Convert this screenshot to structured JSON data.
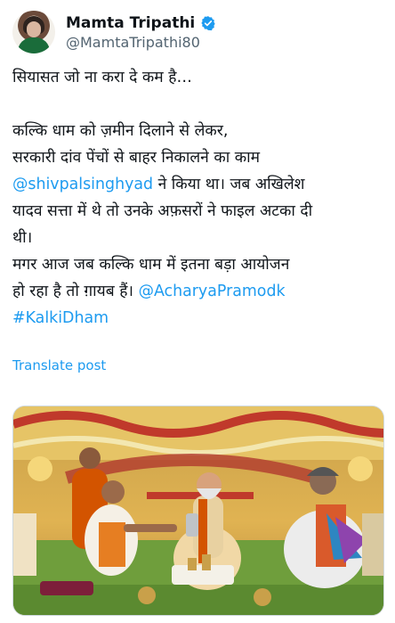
{
  "author": {
    "display_name": "Mamta Tripathi",
    "handle": "@MamtaTripathi80",
    "verified": true,
    "avatar_icon": "profile-avatar"
  },
  "post": {
    "line1": "सियासत जो ना करा दे कम है…",
    "line2": "कल्कि धाम को ज़मीन दिलाने से लेकर,",
    "line3": "सरकारी दांव पेंचों से बाहर निकालने का काम",
    "mention1": "@shivpalsinghyad",
    "line4_rest": " ने किया था। जब अखिलेश",
    "line5": "यादव सत्ता में थे तो उनके अफ़सरों ने फाइल अटका दी",
    "line6": "थी।",
    "line7": "मगर आज जब कल्कि धाम में इतना बड़ा आयोजन",
    "line8_start": "हो रहा है तो ग़ायब हैं। ",
    "mention2": "@AcharyaPramodk",
    "hashtag": "#KalkiDham"
  },
  "translate_label": "Translate post",
  "colors": {
    "link": "#1d9bf0",
    "verified_badge": "#1d9bf0",
    "secondary_text": "#536471"
  }
}
